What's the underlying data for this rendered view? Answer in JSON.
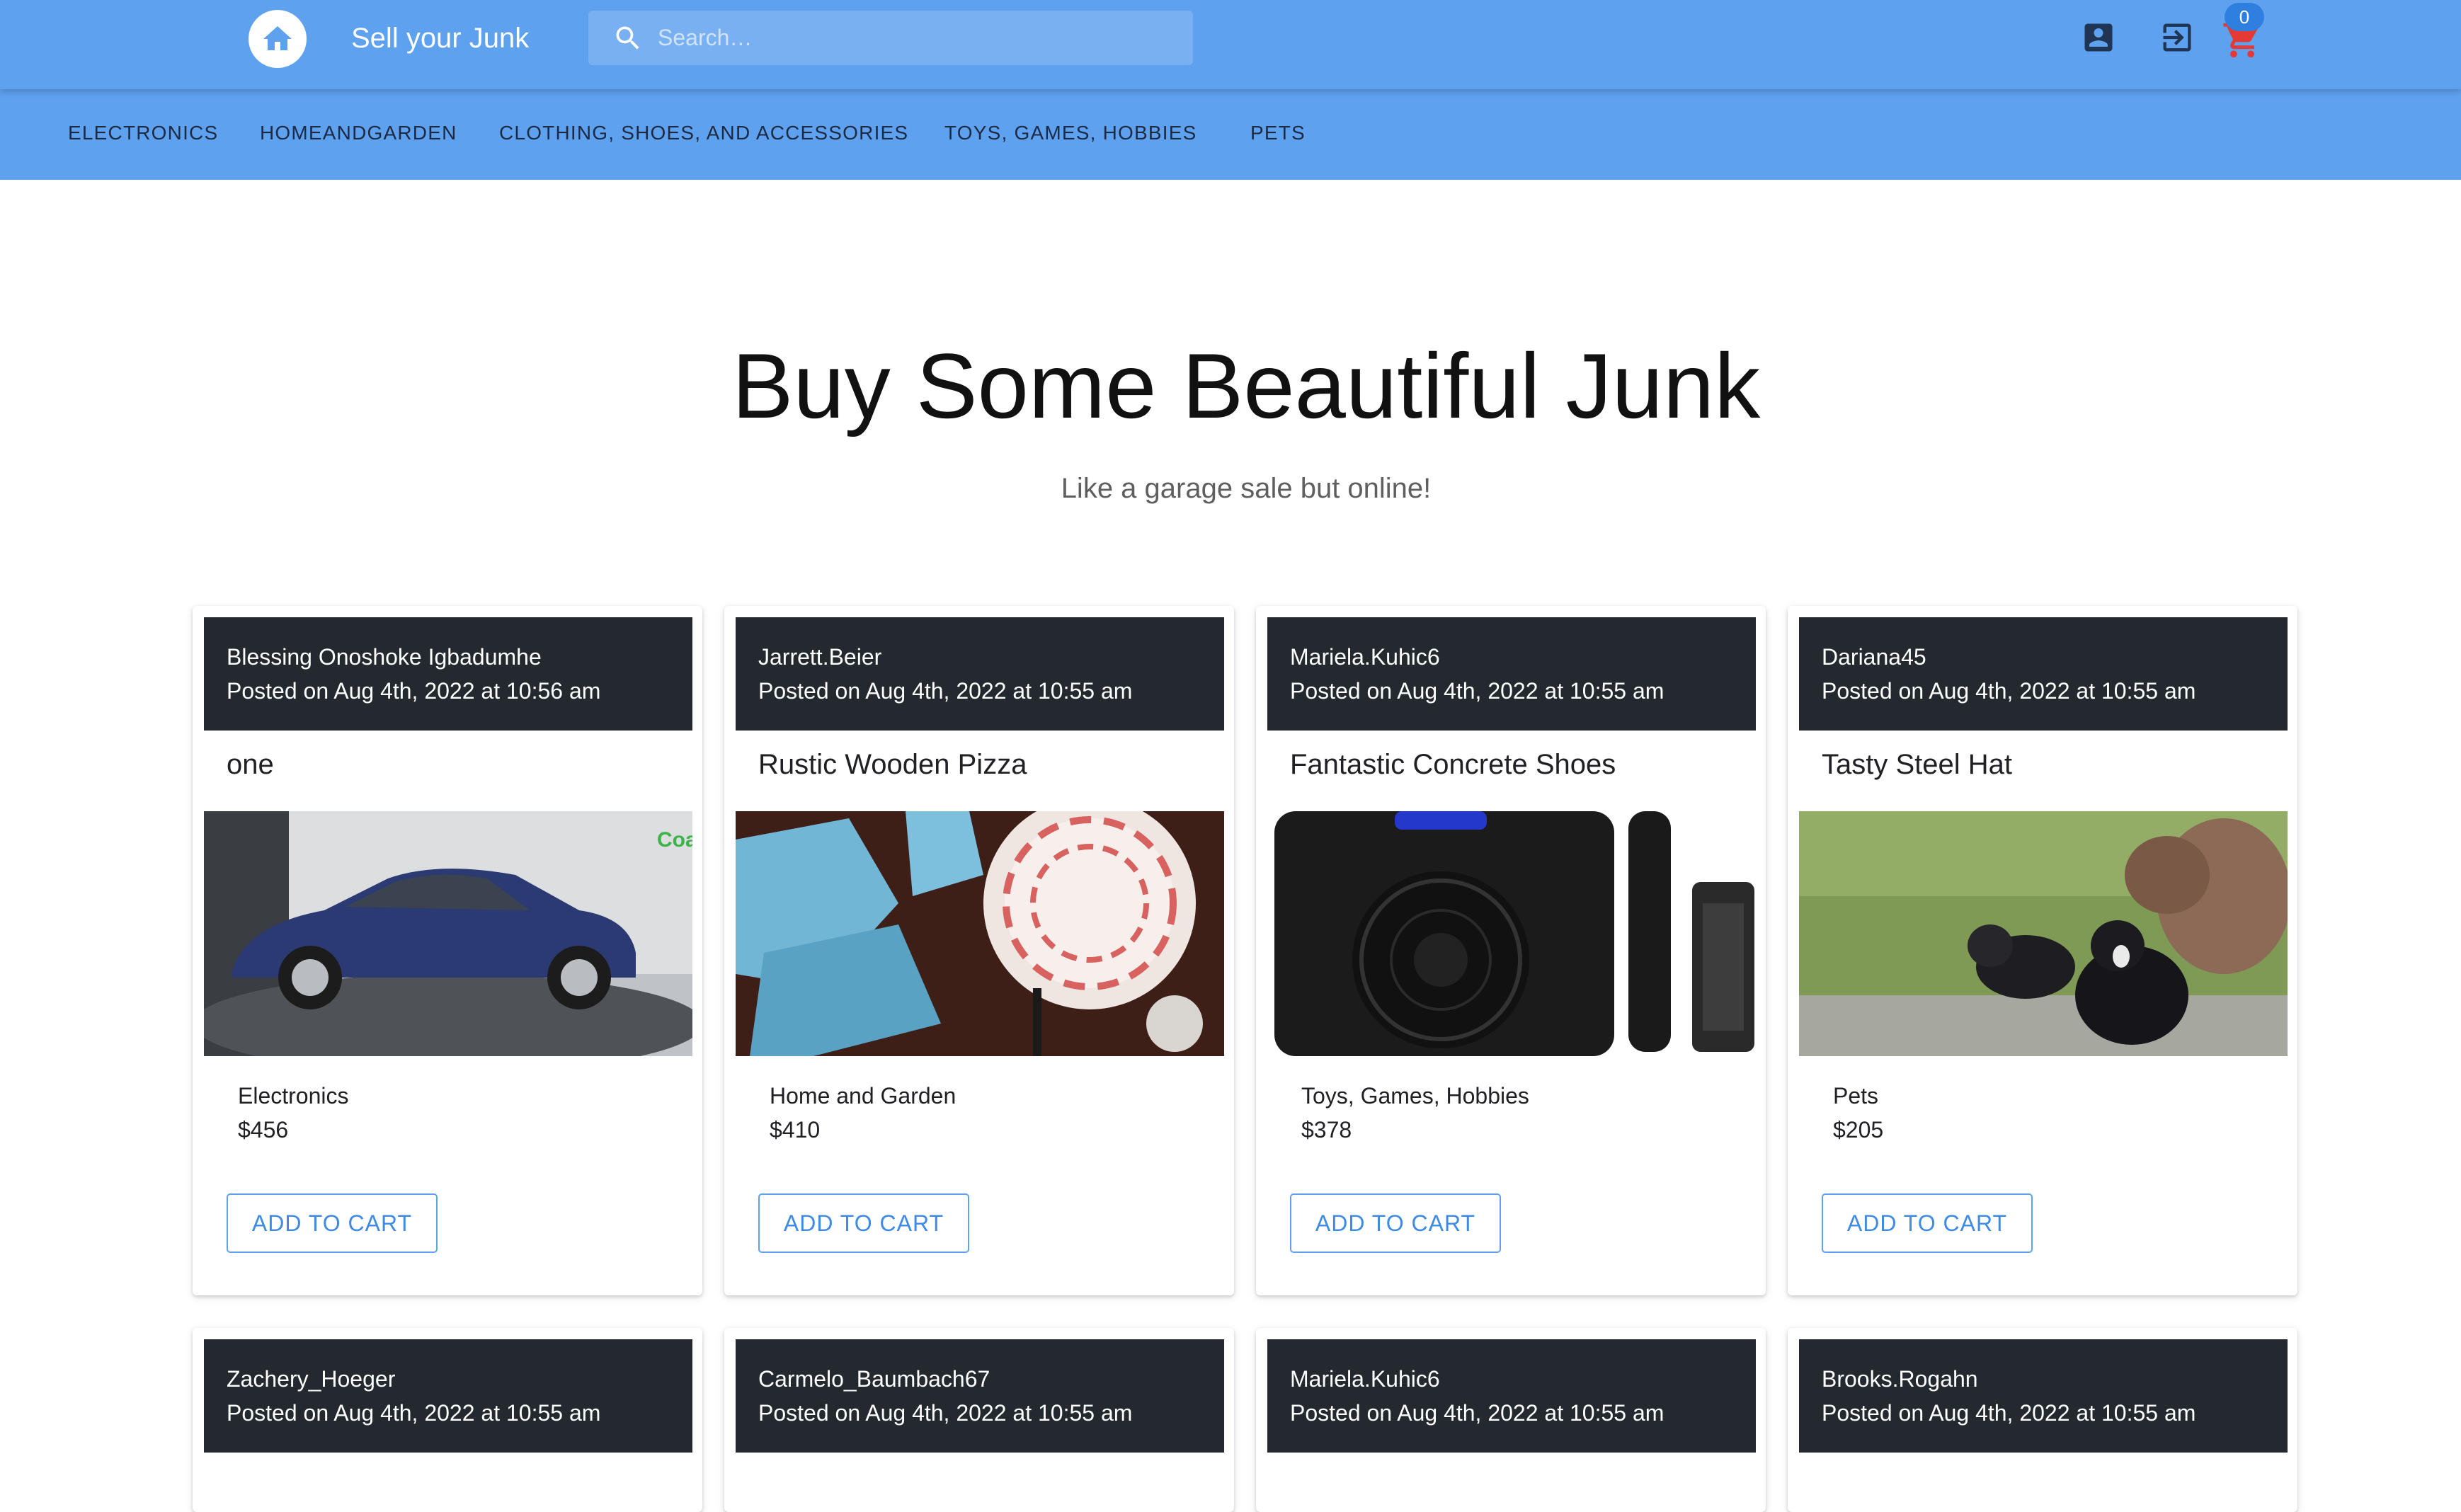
{
  "app": {
    "title": "Sell your Junk",
    "search_placeholder": "Search…",
    "cart_count": "0"
  },
  "nav": {
    "tabs": [
      "ELECTRONICS",
      "HOMEANDGARDEN",
      "CLOTHING, SHOES, AND ACCESSORIES",
      "TOYS, GAMES, HOBBIES",
      "PETS"
    ]
  },
  "hero": {
    "title": "Buy Some Beautiful Junk",
    "subtitle": "Like a garage sale but online!"
  },
  "listings": [
    {
      "author": "Blessing Onoshoke Igbadumhe",
      "posted": "Posted on Aug 4th, 2022 at 10:56 am",
      "title": "one",
      "image": "blue-sedan-car",
      "category": "Electronics",
      "price": "$456",
      "button": "ADD TO CART"
    },
    {
      "author": "Jarrett.Beier",
      "posted": "Posted on Aug 4th, 2022 at 10:55 am",
      "title": "Rustic Wooden Pizza",
      "image": "ceramic-mugs-and-bowl",
      "category": "Home and Garden",
      "price": "$410",
      "button": "ADD TO CART"
    },
    {
      "author": "Mariela.Kuhic6",
      "posted": "Posted on Aug 4th, 2022 at 10:55 am",
      "title": "Fantastic Concrete Shoes",
      "image": "speaker-microphone-remote",
      "category": "Toys, Games, Hobbies",
      "price": "$378",
      "button": "ADD TO CART"
    },
    {
      "author": "Dariana45",
      "posted": "Posted on Aug 4th, 2022 at 10:55 am",
      "title": "Tasty Steel Hat",
      "image": "puppies-on-grass",
      "category": "Pets",
      "price": "$205",
      "button": "ADD TO CART"
    },
    {
      "author": "Zachery_Hoeger",
      "posted": "Posted on Aug 4th, 2022 at 10:55 am"
    },
    {
      "author": "Carmelo_Baumbach67",
      "posted": "Posted on Aug 4th, 2022 at 10:55 am"
    },
    {
      "author": "Mariela.Kuhic6",
      "posted": "Posted on Aug 4th, 2022 at 10:55 am"
    },
    {
      "author": "Brooks.Rogahn",
      "posted": "Posted on Aug 4th, 2022 at 10:55 am"
    }
  ],
  "colors": {
    "appbar": "#5ea1ee",
    "card_header": "#23292f",
    "button_accent": "#3d8be6",
    "cart_icon": "#e53935",
    "badge": "#2f7fe0"
  }
}
